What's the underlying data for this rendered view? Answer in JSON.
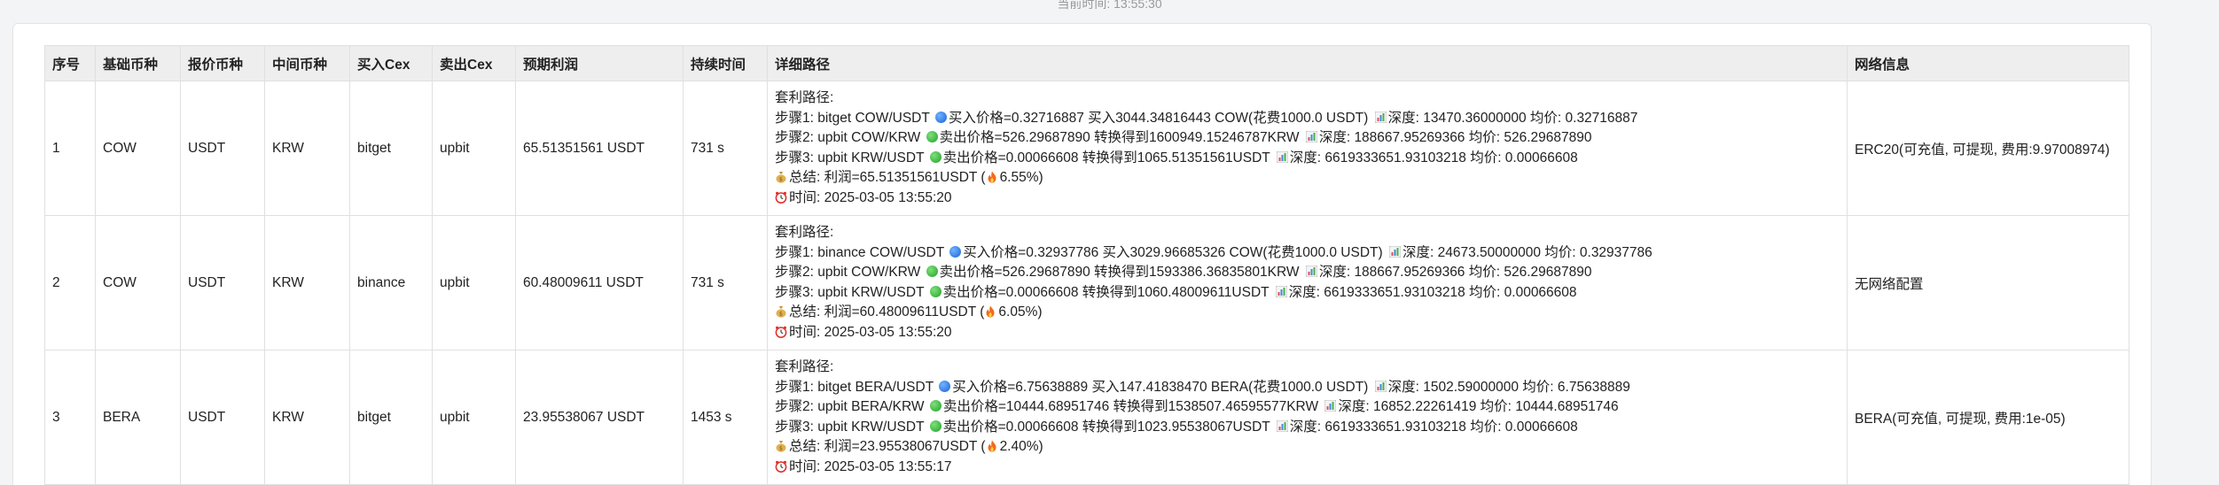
{
  "header": {
    "current_time": "当前时间: 13:55:30"
  },
  "table": {
    "columns": [
      "序号",
      "基础币种",
      "报价币种",
      "中间币种",
      "买入Cex",
      "卖出Cex",
      "预期利润",
      "持续时间",
      "详细路径",
      "网络信息"
    ],
    "rows": [
      {
        "index": "1",
        "base": "COW",
        "quote": "USDT",
        "middle": "KRW",
        "buy_cex": "bitget",
        "sell_cex": "upbit",
        "profit": "65.51351561 USDT",
        "duration": "731 s",
        "path": {
          "title": "套利路径:",
          "step1_prefix": "步骤1: bitget COW/USDT ",
          "step1_action": "买入价格=0.32716887 买入3044.34816443 COW(花费1000.0 USDT) ",
          "step1_depth": "深度: 13470.36000000 均价: 0.32716887",
          "step2_prefix": "步骤2: upbit COW/KRW ",
          "step2_action": "卖出价格=526.29687890 转换得到1600949.15246787KRW ",
          "step2_depth": "深度: 188667.95269366 均价: 526.29687890",
          "step3_prefix": "步骤3: upbit KRW/USDT ",
          "step3_action": "卖出价格=0.00066608 转换得到1065.51351561USDT ",
          "step3_depth": "深度: 6619333651.93103218 均价: 0.00066608",
          "summary_prefix": "总结: 利润=65.51351561USDT (",
          "summary_pct": "6.55%)",
          "time": "时间: 2025-03-05 13:55:20"
        },
        "network": "ERC20(可充值, 可提现, 费用:9.97008974)"
      },
      {
        "index": "2",
        "base": "COW",
        "quote": "USDT",
        "middle": "KRW",
        "buy_cex": "binance",
        "sell_cex": "upbit",
        "profit": "60.48009611 USDT",
        "duration": "731 s",
        "path": {
          "title": "套利路径:",
          "step1_prefix": "步骤1: binance COW/USDT ",
          "step1_action": "买入价格=0.32937786 买入3029.96685326 COW(花费1000.0 USDT) ",
          "step1_depth": "深度: 24673.50000000 均价: 0.32937786",
          "step2_prefix": "步骤2: upbit COW/KRW ",
          "step2_action": "卖出价格=526.29687890 转换得到1593386.36835801KRW ",
          "step2_depth": "深度: 188667.95269366 均价: 526.29687890",
          "step3_prefix": "步骤3: upbit KRW/USDT ",
          "step3_action": "卖出价格=0.00066608 转换得到1060.48009611USDT ",
          "step3_depth": "深度: 6619333651.93103218 均价: 0.00066608",
          "summary_prefix": "总结: 利润=60.48009611USDT (",
          "summary_pct": "6.05%)",
          "time": "时间: 2025-03-05 13:55:20"
        },
        "network": "无网络配置"
      },
      {
        "index": "3",
        "base": "BERA",
        "quote": "USDT",
        "middle": "KRW",
        "buy_cex": "bitget",
        "sell_cex": "upbit",
        "profit": "23.95538067 USDT",
        "duration": "1453 s",
        "path": {
          "title": "套利路径:",
          "step1_prefix": "步骤1: bitget BERA/USDT ",
          "step1_action": "买入价格=6.75638889 买入147.41838470 BERA(花费1000.0 USDT) ",
          "step1_depth": "深度: 1502.59000000 均价: 6.75638889",
          "step2_prefix": "步骤2: upbit BERA/KRW ",
          "step2_action": "卖出价格=10444.68951746 转换得到1538507.46595577KRW ",
          "step2_depth": "深度: 16852.22261419 均价: 10444.68951746",
          "step3_prefix": "步骤3: upbit KRW/USDT ",
          "step3_action": "卖出价格=0.00066608 转换得到1023.95538067USDT ",
          "step3_depth": "深度: 6619333651.93103218 均价: 0.00066608",
          "summary_prefix": "总结: 利润=23.95538067USDT (",
          "summary_pct": "2.40%)",
          "time": "时间: 2025-03-05 13:55:17"
        },
        "network": "BERA(可充值, 可提现, 费用:1e-05)"
      }
    ]
  }
}
